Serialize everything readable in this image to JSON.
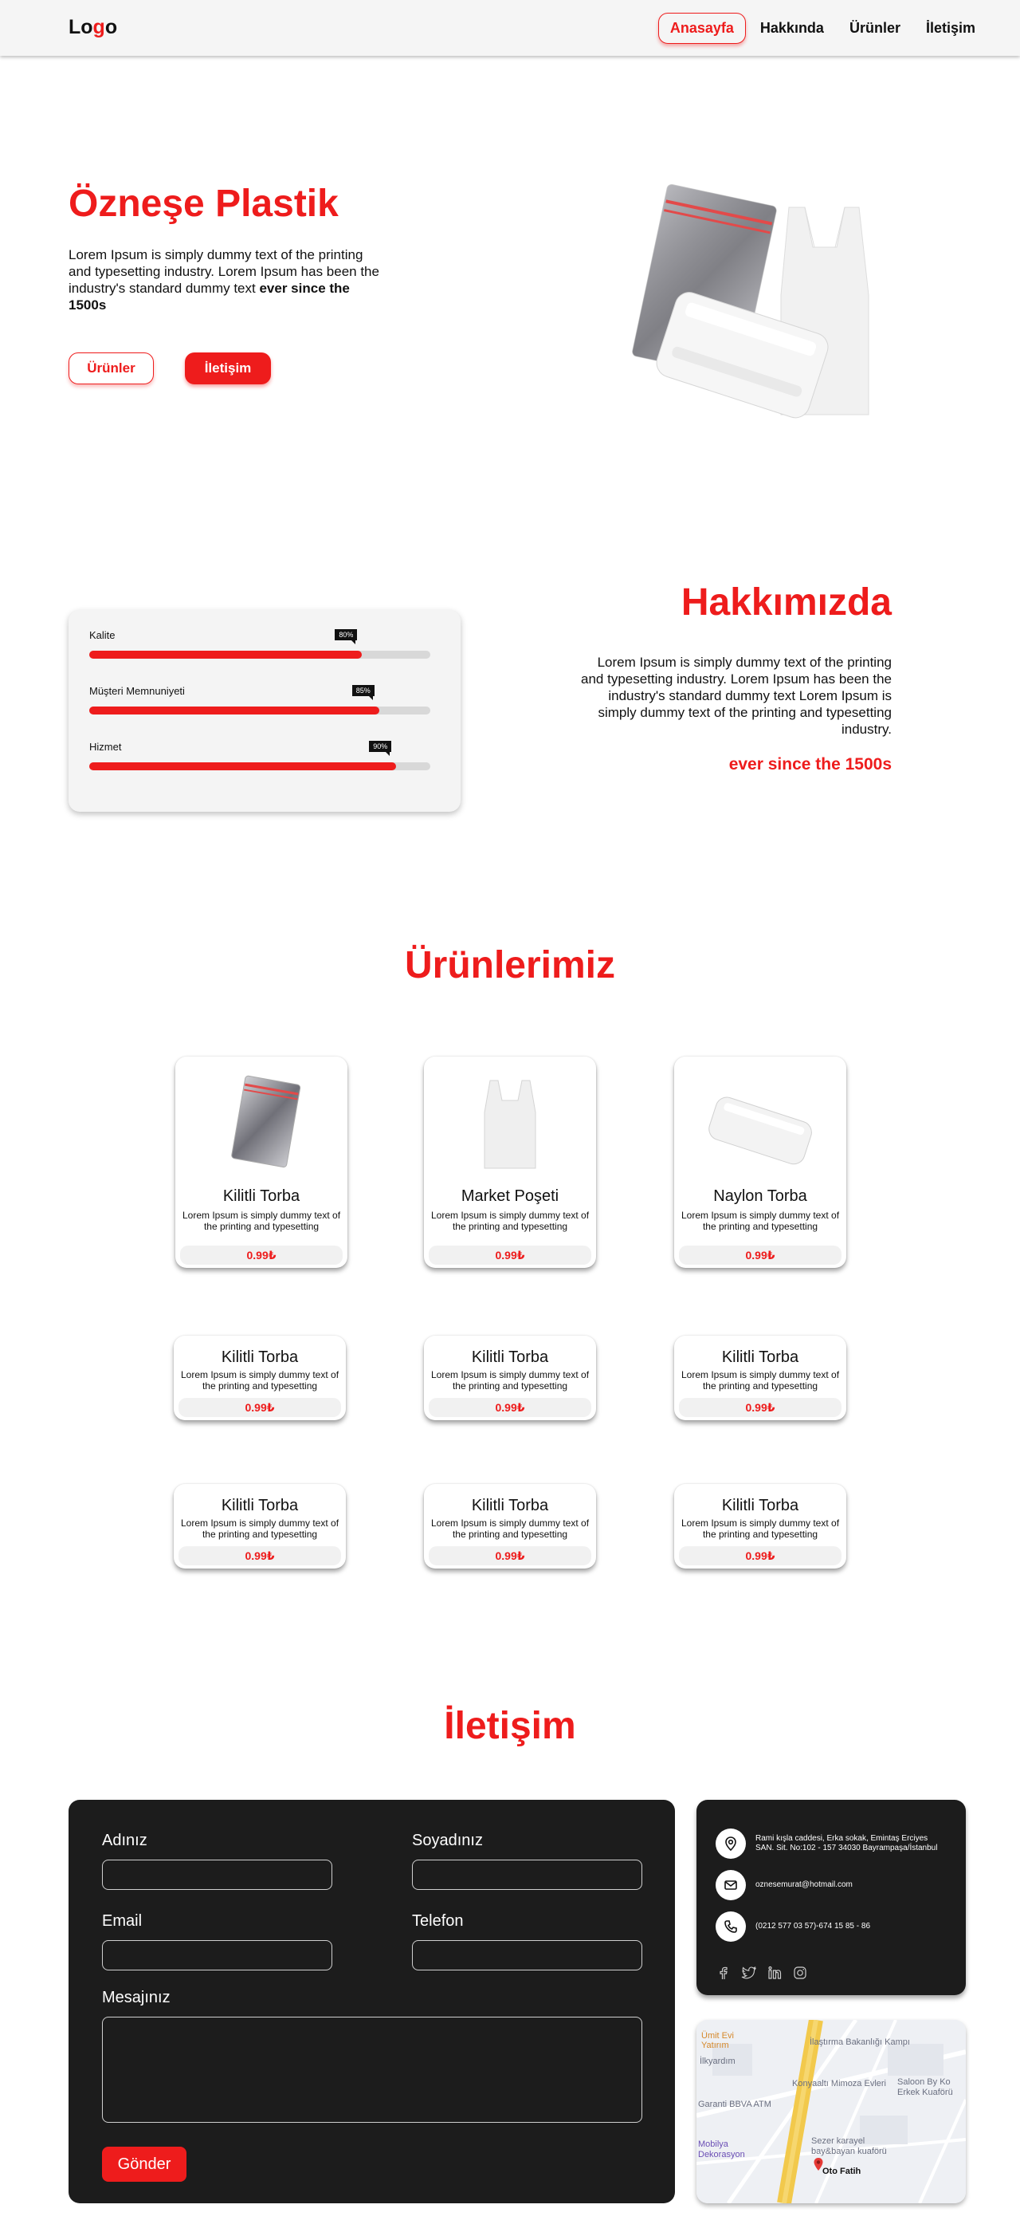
{
  "nav": {
    "logo_prefix": "Lo",
    "logo_accent": "g",
    "logo_suffix": "o",
    "links": [
      "Anasayfa",
      "Hakkında",
      "Ürünler",
      "İletişim"
    ]
  },
  "hero": {
    "title": "Özneşe Plastik",
    "text": "Lorem Ipsum is simply dummy text of the printing and typesetting industry. Lorem Ipsum has been the industry's standard dummy text",
    "text_bold": "ever since the 1500s",
    "btn_products": "Ürünler",
    "btn_contact": "İletişim"
  },
  "about": {
    "title": "Hakkımızda",
    "text": "Lorem Ipsum is simply dummy text of the printing and typesetting industry. Lorem Ipsum has been the industry's standard dummy text Lorem Ipsum is simply dummy text of the printing and typesetting industry.",
    "subtitle": "ever since the 1500s",
    "skills": [
      {
        "label": "Kalite",
        "percent_text": "80%",
        "value": 80
      },
      {
        "label": "Müşteri Memnuniyeti",
        "percent_text": "85%",
        "value": 85
      },
      {
        "label": "Hizmet",
        "percent_text": "90%",
        "value": 90
      }
    ]
  },
  "products": {
    "title": "Ürünlerimiz",
    "items": [
      {
        "name": "Kilitli Torba",
        "desc": "Lorem Ipsum is simply dummy text of the printing and typesetting",
        "price": "0.99₺"
      },
      {
        "name": "Market Poşeti",
        "desc": "Lorem Ipsum is simply dummy text of the printing and typesetting",
        "price": "0.99₺"
      },
      {
        "name": "Naylon Torba",
        "desc": "Lorem Ipsum is simply dummy text of the printing and typesetting",
        "price": "0.99₺"
      },
      {
        "name": "Kilitli Torba",
        "desc": "Lorem Ipsum is simply dummy text of the printing and typesetting",
        "price": "0.99₺"
      },
      {
        "name": "Kilitli Torba",
        "desc": "Lorem Ipsum is simply dummy text of the printing and typesetting",
        "price": "0.99₺"
      },
      {
        "name": "Kilitli Torba",
        "desc": "Lorem Ipsum is simply dummy text of the printing and typesetting",
        "price": "0.99₺"
      },
      {
        "name": "Kilitli Torba",
        "desc": "Lorem Ipsum is simply dummy text of the printing and typesetting",
        "price": "0.99₺"
      },
      {
        "name": "Kilitli Torba",
        "desc": "Lorem Ipsum is simply dummy text of the printing and typesetting",
        "price": "0.99₺"
      },
      {
        "name": "Kilitli Torba",
        "desc": "Lorem Ipsum is simply dummy text of the printing and typesetting",
        "price": "0.99₺"
      }
    ]
  },
  "contact": {
    "title": "İletişim",
    "form": {
      "first_name": "Adınız",
      "last_name": "Soyadınız",
      "email": "Email",
      "phone": "Telefon",
      "message": "Mesajınız",
      "submit": "Gönder"
    },
    "info": {
      "address": "Rami kışla caddesi, Erka sokak, Emintaş Erciyes SAN. Sit. No:102 - 157 34030 Bayrampaşa/İstanbul",
      "email": "oznesemurat@hotmail.com",
      "phone": "(0212 577 03 57)-674 15 85 - 86"
    },
    "socials": [
      "facebook-icon",
      "twitter-icon",
      "linkedin-icon",
      "instagram-icon"
    ],
    "map": {
      "labels": [
        "Ümit Evi",
        "Yatırım",
        "İlkyardım",
        "İlaştırma Bakanlığı Kampı",
        "Konyaaltı Mimoza Evleri",
        "Saloon By Ko Erkek Kuaförü",
        "Garanti BBVA ATM",
        "Sezer karayel bay&bayan kuaförü",
        "Mobilya Dekorasyon",
        "Oto Fatih"
      ]
    }
  },
  "colors": {
    "accent": "#ee1c1c",
    "dark_panel": "#1c1c1c",
    "nav_bg": "#f5f5f5"
  }
}
